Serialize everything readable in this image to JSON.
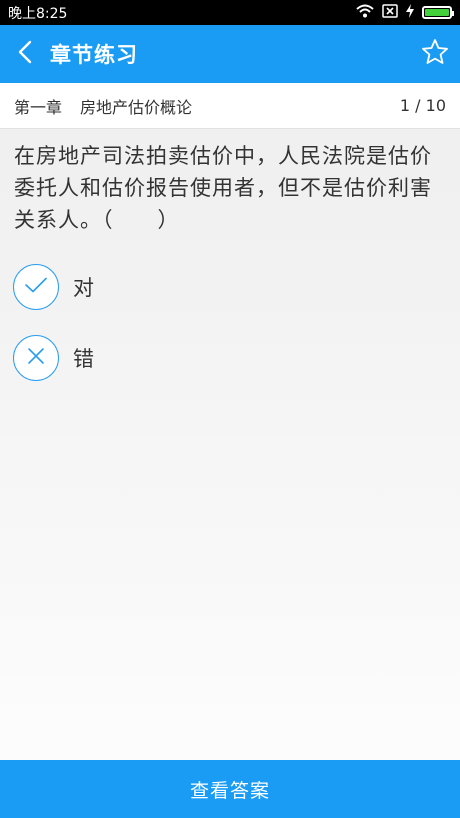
{
  "status": {
    "time": "晚上8:25"
  },
  "appbar": {
    "title": "章节练习",
    "back_icon": "chevron-left-icon",
    "favorite_icon": "star-icon"
  },
  "chapter": {
    "number": "第一章",
    "name": "房地产估价概论",
    "progress": "1 / 10"
  },
  "question": {
    "text": "在房地产司法拍卖估价中，人民法院是估价委托人和估价报告使用者，但不是估价利害关系人。（　　）"
  },
  "options": [
    {
      "label": "对",
      "icon": "check-icon"
    },
    {
      "label": "错",
      "icon": "cross-icon"
    }
  ],
  "footer": {
    "answer_label": "查看答案"
  },
  "colors": {
    "accent": "#1a9cf4",
    "status_bar": "#000000",
    "battery": "#43d13c"
  }
}
